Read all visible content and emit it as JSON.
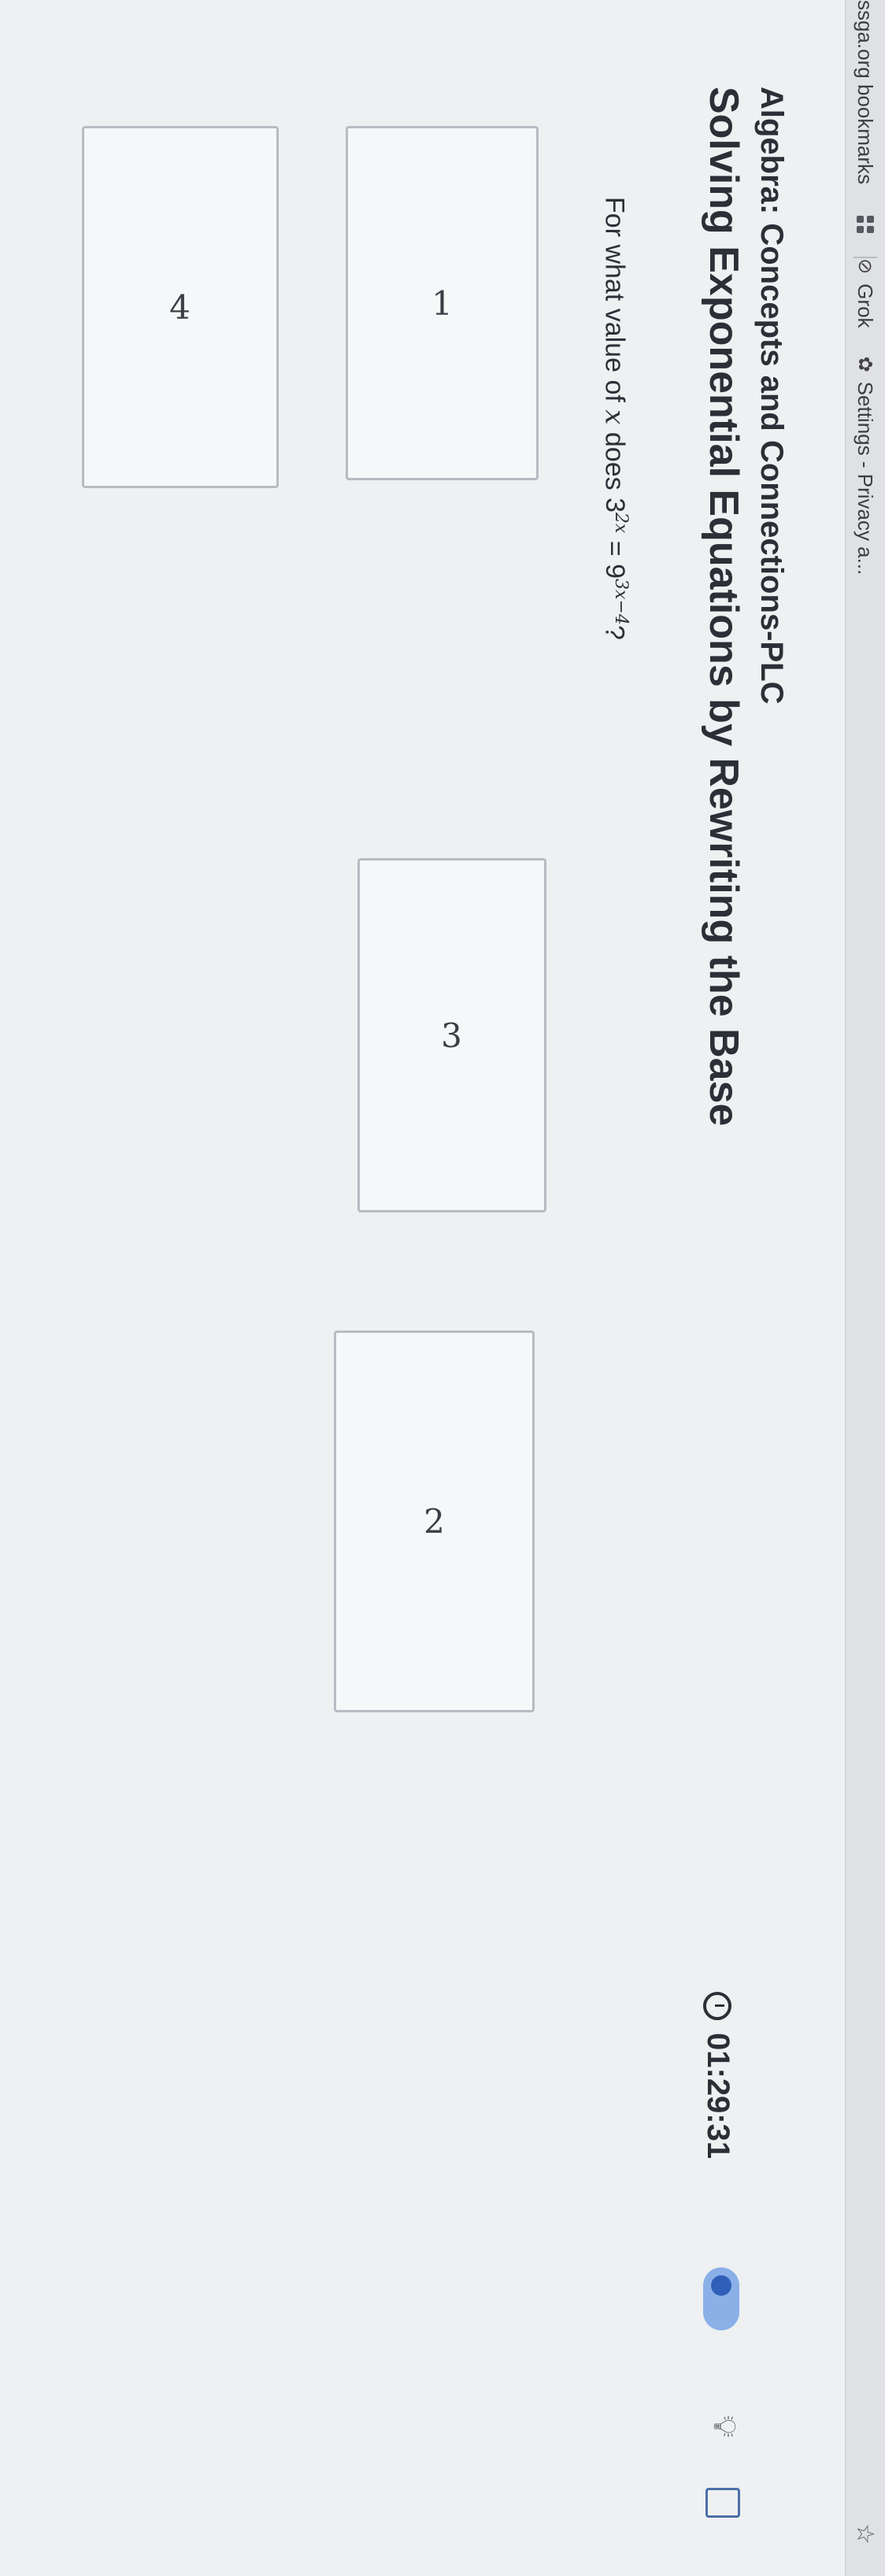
{
  "bookmarks_bar": {
    "items": [
      {
        "label": "ssga.org bookmarks"
      },
      {
        "label": "Grok"
      },
      {
        "label": "Settings - Privacy a..."
      }
    ]
  },
  "header": {
    "course": "Algebra: Concepts and Connections-PLC",
    "title": "Solving Exponential Equations by Rewriting the Base",
    "timer": "01:29:31"
  },
  "question": {
    "prefix": "For what value of",
    "variable": "x",
    "middle": "does",
    "lhs_base": "3",
    "lhs_exp": "2x",
    "equals": "=",
    "rhs_base": "9",
    "rhs_exp": "3x−4",
    "suffix": "?"
  },
  "answers": [
    "1",
    "3",
    "2",
    "4"
  ],
  "icons": {
    "apps": "apps-grid-icon",
    "grok": "grok-icon",
    "settings": "gear-icon",
    "star": "star-icon",
    "clock": "clock-icon",
    "hint": "lightbulb-icon",
    "page": "page-icon"
  }
}
